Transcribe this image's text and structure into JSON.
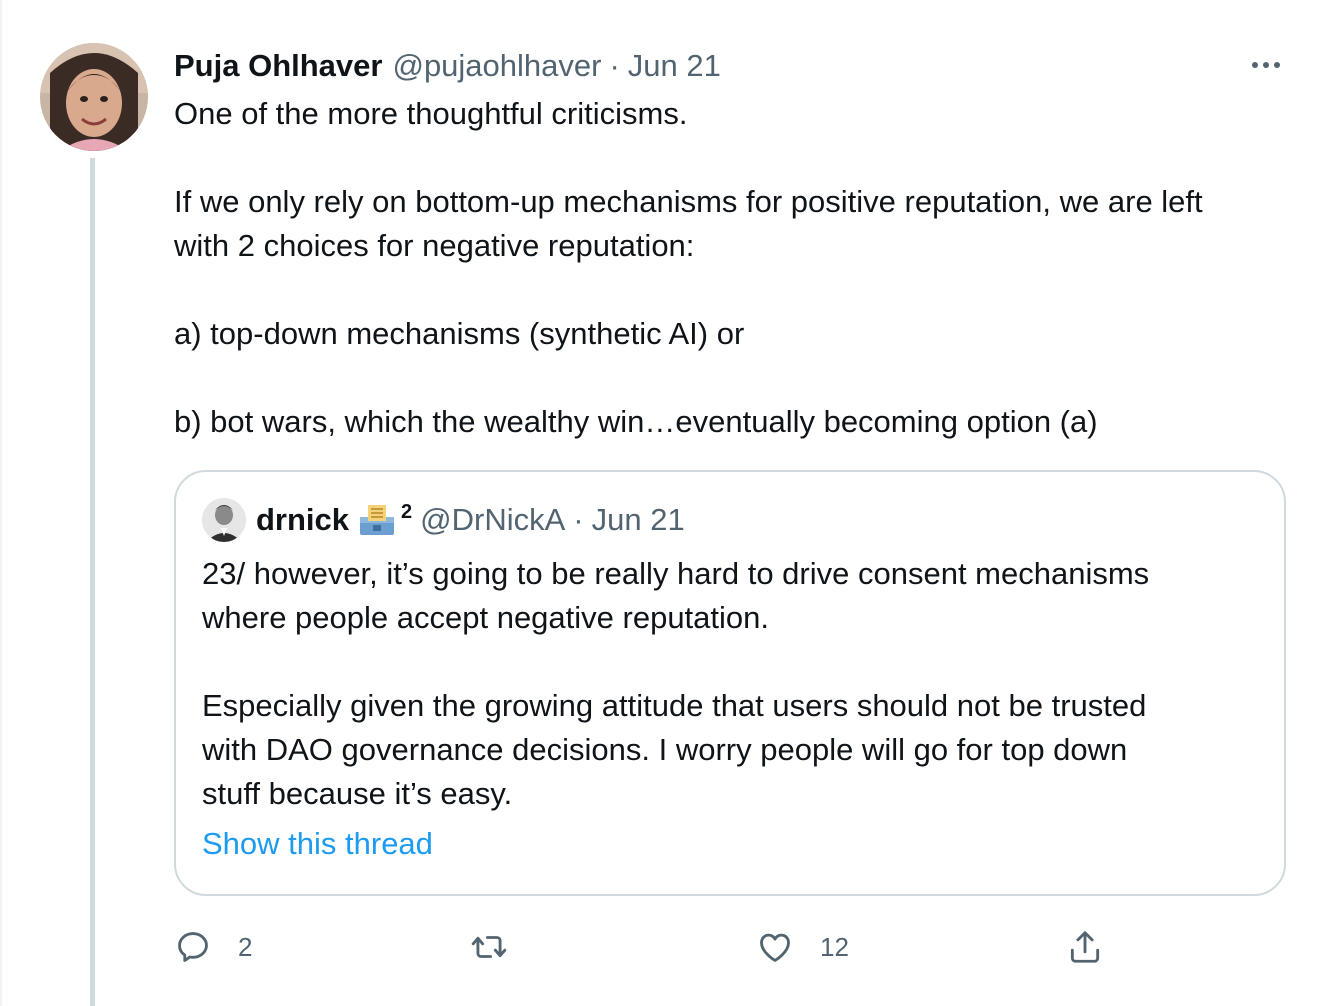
{
  "tweet": {
    "author_name": "Puja Ohlhaver",
    "author_handle": "@pujaohlhaver",
    "separator": "·",
    "date": "Jun 21",
    "text_lines": [
      "One of the more thoughtful criticisms.",
      "",
      "If we only rely on bottom-up mechanisms for positive reputation, we are left",
      "with 2 choices for negative reputation:",
      "",
      "a) top-down mechanisms (synthetic AI) or",
      "",
      "b) bot wars, which the wealthy win…eventually becoming option (a)"
    ]
  },
  "quote": {
    "author_name": "drnick",
    "superscript": "2",
    "author_handle": "@DrNickA",
    "separator": "·",
    "date": "Jun 21",
    "text_lines": [
      "23/ however, it’s going to be really hard to drive consent mechanisms",
      "where people accept negative reputation.",
      "",
      "Especially given the growing attitude that users should not be trusted",
      "with DAO governance decisions. I worry people will go for top down",
      "stuff because it’s easy."
    ],
    "show_thread_label": "Show this thread"
  },
  "actions": {
    "reply_count": "2",
    "retweet_count": "",
    "like_count": "12"
  },
  "icons": {
    "more": "more-horizontal-icon",
    "reply": "reply-icon",
    "retweet": "retweet-icon",
    "like": "heart-icon",
    "share": "share-icon",
    "emoji": "ballot-box-emoji"
  },
  "colors": {
    "text": "#0f1419",
    "secondary": "#536471",
    "link": "#1d9bf0",
    "border": "#cfd9de"
  }
}
